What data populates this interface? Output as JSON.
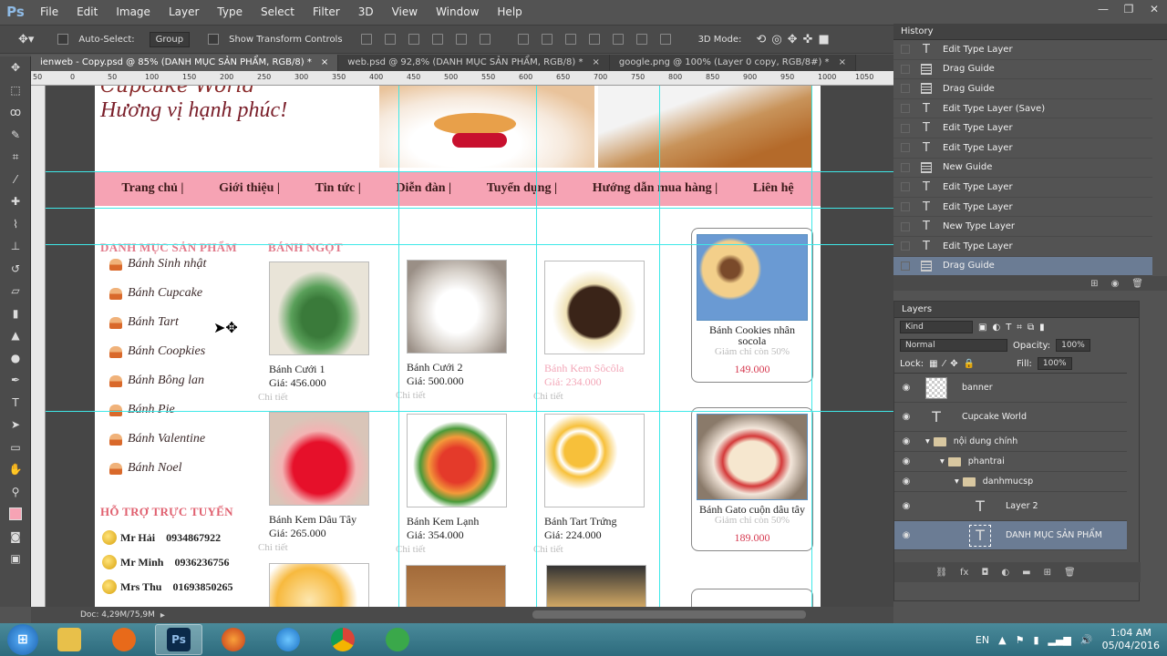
{
  "app": {
    "logo": "Ps",
    "menus": [
      "File",
      "Edit",
      "Image",
      "Layer",
      "Type",
      "Select",
      "Filter",
      "3D",
      "View",
      "Window",
      "Help"
    ]
  },
  "options": {
    "auto_select_label": "Auto-Select:",
    "auto_select_value": "Group",
    "transform_label": "Show Transform Controls",
    "mode_label": "3D Mode:"
  },
  "tabs": [
    {
      "label": "ienweb - Copy.psd @ 85% (DANH MỤC SẢN PHẨM, RGB/8) *",
      "close": "×"
    },
    {
      "label": "web.psd @ 92,8% (DANH MỤC SẢN PHẨM, RGB/8) *",
      "close": "×"
    },
    {
      "label": "google.png @ 100% (Layer 0 copy, RGB/8#) *",
      "close": "×"
    }
  ],
  "ruler_labels": [
    "50",
    "0",
    "50",
    "100",
    "150",
    "200",
    "250",
    "300",
    "350",
    "400",
    "450",
    "500",
    "550",
    "600",
    "650",
    "700",
    "750",
    "800",
    "850",
    "900",
    "950",
    "1000",
    "1050"
  ],
  "site": {
    "title": "Cupcake World",
    "slogan": "Hương vị hạnh phúc!",
    "nav": [
      "Trang chủ |",
      "Giới thiệu |",
      "Tin tức |",
      "Diễn đàn |",
      "Tuyển dụng |",
      "Hướng dẫn mua hàng |",
      "Liên hệ"
    ],
    "cat_heading": "DANH MỤC SẢN PHẨM",
    "cake_heading": "BÁNH NGỌT",
    "categories": [
      "Bánh Sinh nhật",
      "Bánh Cupcake",
      "Bánh Tart",
      "Bánh Coopkies",
      "Bánh Bông lan",
      "Bánh Pie",
      "Bánh Valentine",
      "Bánh Noel"
    ],
    "support_heading": "HỖ TRỢ TRỰC TUYẾN",
    "support": [
      {
        "name": "Mr Hải",
        "phone": "0934867922"
      },
      {
        "name": "Mr Minh",
        "phone": "0936236756"
      },
      {
        "name": "Mrs Thu",
        "phone": "01693850265"
      }
    ],
    "products": [
      {
        "name": "Bánh Cưới 1",
        "price": "Giá: 456.000",
        "detail": "Chi tiết"
      },
      {
        "name": "Bánh Cưới 2",
        "price": "Giá: 500.000",
        "detail": "Chi tiết"
      },
      {
        "name": "Bánh Kem Sôcôla",
        "price": "Giá: 234.000",
        "detail": "Chi tiết"
      },
      {
        "name": "Bánh Kem Dâu Tây",
        "price": "Giá: 265.000",
        "detail": "Chi tiết"
      },
      {
        "name": "Bánh Kem Lạnh",
        "price": "Giá: 354.000",
        "detail": "Chi tiết"
      },
      {
        "name": "Bánh Tart Trứng",
        "price": "Giá: 224.000",
        "detail": "Chi tiết"
      }
    ],
    "side": [
      {
        "name": "Bánh Cookies nhân socola",
        "discount": "Giảm chỉ còn 50%",
        "price": "149.000"
      },
      {
        "name": "Bánh Gato cuộn dâu tây",
        "discount": "Giảm chỉ còn 50%",
        "price": "189.000"
      }
    ]
  },
  "status": {
    "doc": "Doc: 4,29M/75,9M"
  },
  "history": {
    "title": "History",
    "items": [
      {
        "label": "Edit Type Layer",
        "icon": "type"
      },
      {
        "label": "Drag Guide",
        "icon": "doc"
      },
      {
        "label": "Drag Guide",
        "icon": "doc"
      },
      {
        "label": "Edit Type Layer (Save)",
        "icon": "type"
      },
      {
        "label": "Edit Type Layer",
        "icon": "type"
      },
      {
        "label": "Edit Type Layer",
        "icon": "type"
      },
      {
        "label": "New Guide",
        "icon": "doc"
      },
      {
        "label": "Edit Type Layer",
        "icon": "type"
      },
      {
        "label": "Edit Type Layer",
        "icon": "type"
      },
      {
        "label": "New Type Layer",
        "icon": "type"
      },
      {
        "label": "Edit Type Layer",
        "icon": "type"
      },
      {
        "label": "Drag Guide",
        "icon": "doc"
      }
    ]
  },
  "layers": {
    "title": "Layers",
    "filter": "Kind",
    "blend": "Normal",
    "opacity_label": "Opacity:",
    "opacity": "100%",
    "lock_label": "Lock:",
    "fill_label": "Fill:",
    "fill": "100%",
    "items": [
      {
        "label": "banner",
        "kind": "image"
      },
      {
        "label": "Cupcake World",
        "kind": "text"
      },
      {
        "label": "nội dung chính",
        "kind": "group"
      },
      {
        "label": "phantrai",
        "kind": "group"
      },
      {
        "label": "danhmucsp",
        "kind": "group"
      },
      {
        "label": "Layer 2",
        "kind": "text"
      },
      {
        "label": "DANH MỤC SẢN PHẨM",
        "kind": "text"
      }
    ]
  },
  "taskbar": {
    "lang": "EN",
    "time": "1:04 AM",
    "date": "05/04/2016"
  },
  "colors": {
    "guide": "#3ee8e8",
    "nav": "#f6a3b4",
    "heading": "#e07a8b",
    "price": "#d63a50",
    "selected": "#6b7c94"
  }
}
